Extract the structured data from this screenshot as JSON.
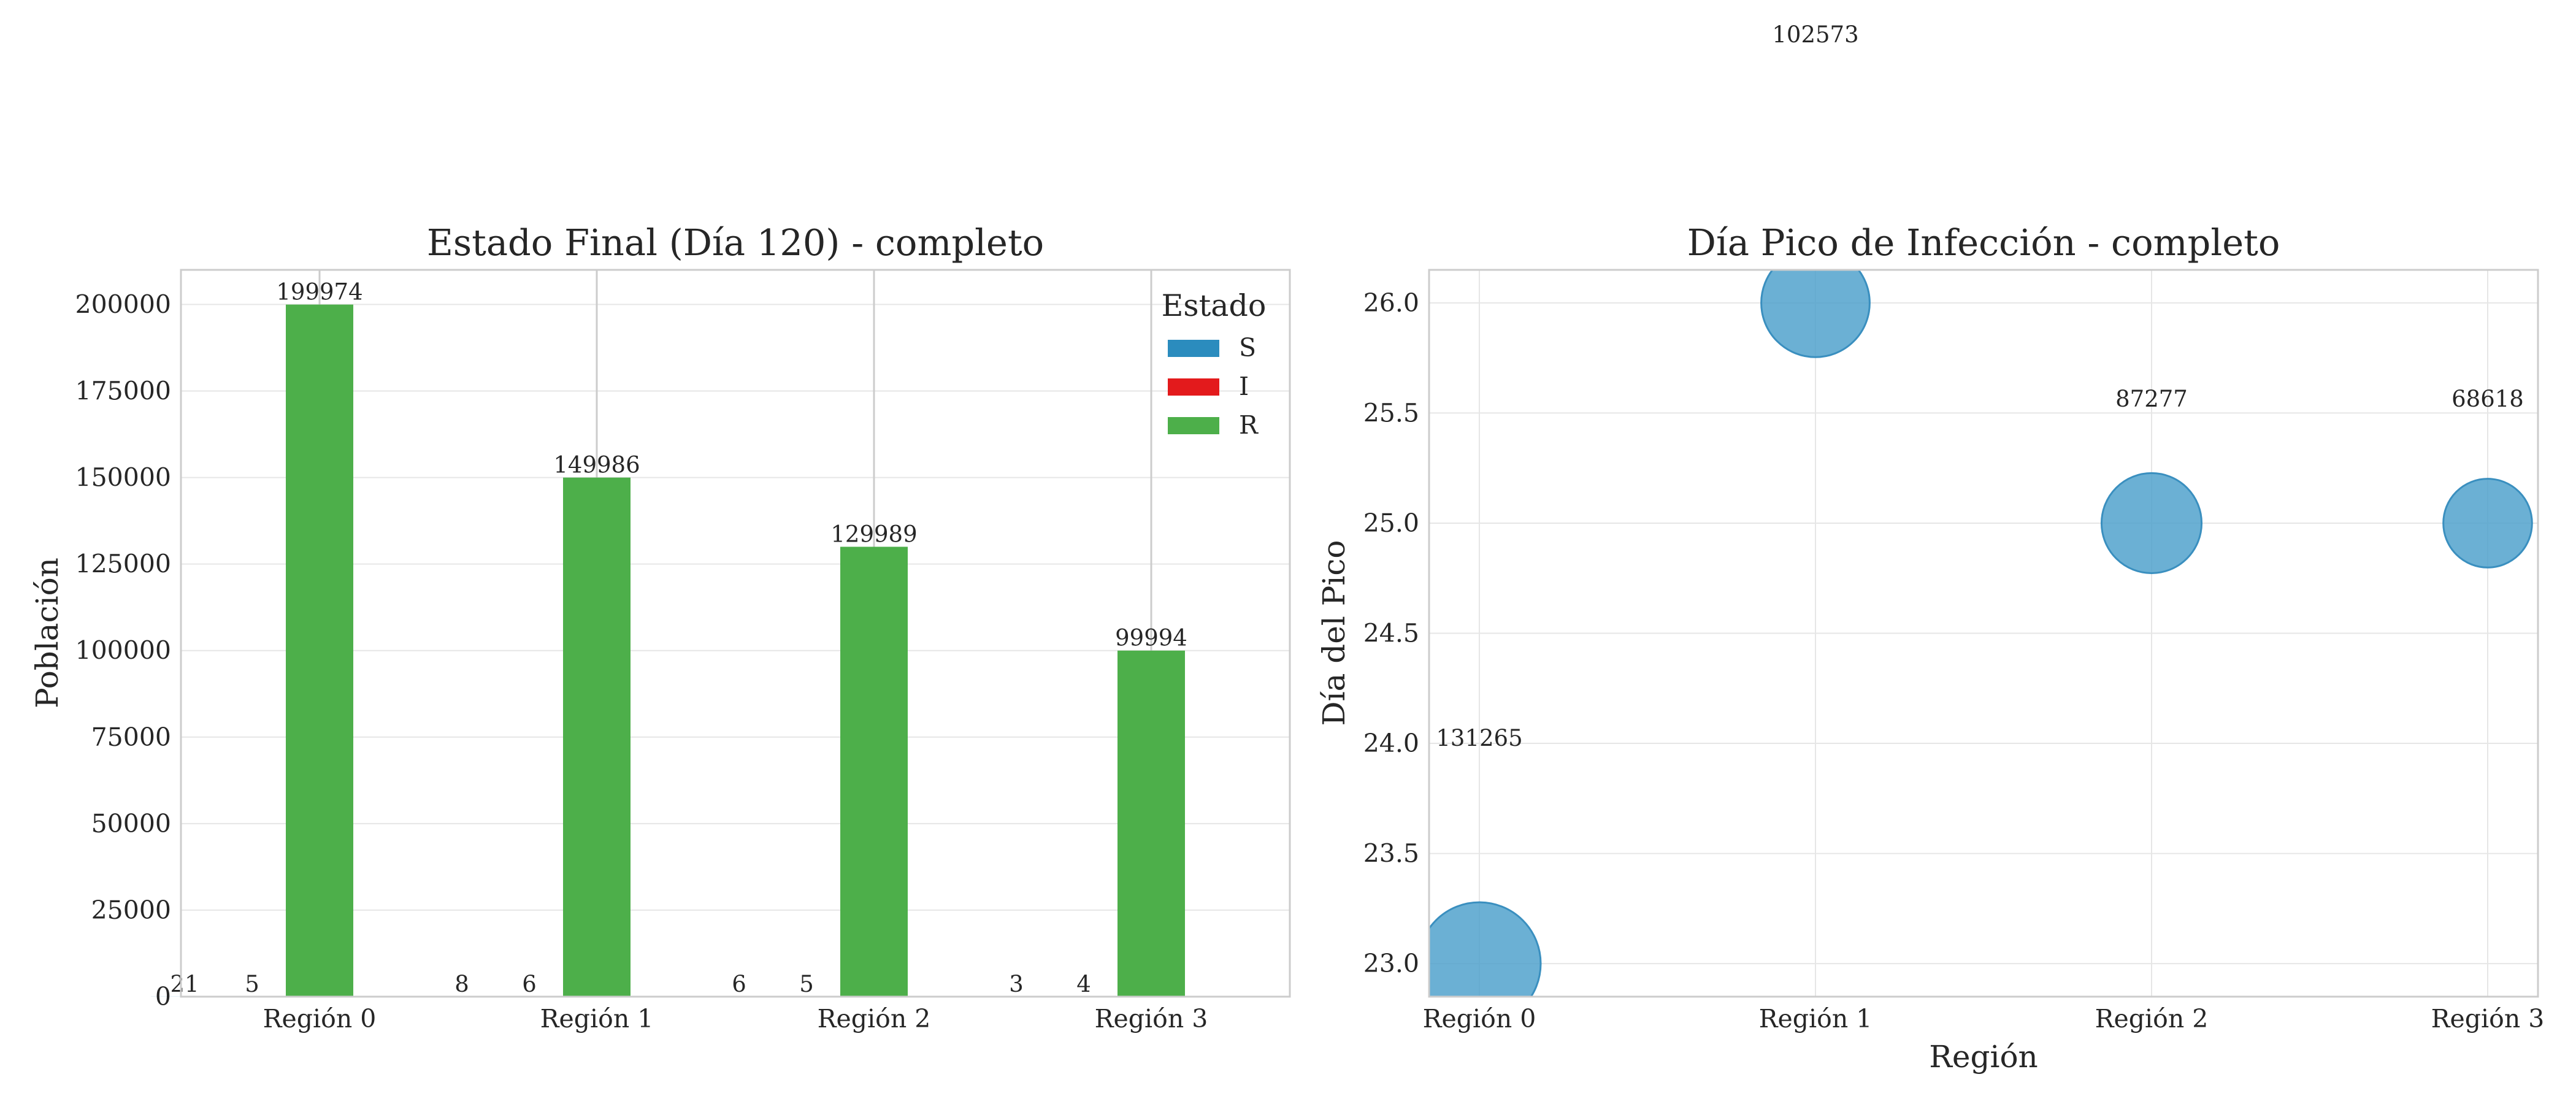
{
  "colors": {
    "S": "#2b8cbe",
    "I": "#e31a1c",
    "R": "#4daf4a",
    "bubble": "#4a9fcb",
    "grid": "#e6e6e6",
    "spine": "#cccccc"
  },
  "left": {
    "title": "Estado Final (Día 120) - completo",
    "ylabel": "Población",
    "legend_title": "Estado"
  },
  "right": {
    "title": "Día Pico de Infección - completo",
    "xlabel": "Región",
    "ylabel": "Día del Pico"
  },
  "chart_data": [
    {
      "type": "bar",
      "title": "Estado Final (Día 120) - completo",
      "xlabel": "",
      "ylabel": "Población",
      "categories": [
        "Región 0",
        "Región 1",
        "Región 2",
        "Región 3"
      ],
      "series": [
        {
          "name": "S",
          "values": [
            21,
            8,
            6,
            3
          ]
        },
        {
          "name": "I",
          "values": [
            5,
            6,
            5,
            4
          ]
        },
        {
          "name": "R",
          "values": [
            199974,
            149986,
            129989,
            99994
          ]
        }
      ],
      "ylim": [
        0,
        210000
      ],
      "yticks": [
        0,
        25000,
        50000,
        75000,
        100000,
        125000,
        150000,
        175000,
        200000
      ],
      "legend": "top-right",
      "grid": true
    },
    {
      "type": "scatter",
      "title": "Día Pico de Infección - completo",
      "xlabel": "Región",
      "ylabel": "Día del Pico",
      "categories": [
        "Región 0",
        "Región 1",
        "Región 2",
        "Región 3"
      ],
      "points": [
        {
          "x": "Región 0",
          "y": 23.0,
          "size": 131265,
          "label": "131265"
        },
        {
          "x": "Región 1",
          "y": 26.0,
          "size": 102573,
          "label": "102573"
        },
        {
          "x": "Región 2",
          "y": 25.0,
          "size": 87277,
          "label": "87277"
        },
        {
          "x": "Región 3",
          "y": 25.0,
          "size": 68618,
          "label": "68618"
        }
      ],
      "ylim": [
        22.85,
        26.15
      ],
      "yticks": [
        23.0,
        23.5,
        24.0,
        24.5,
        25.0,
        25.5,
        26.0
      ],
      "grid": true
    }
  ]
}
